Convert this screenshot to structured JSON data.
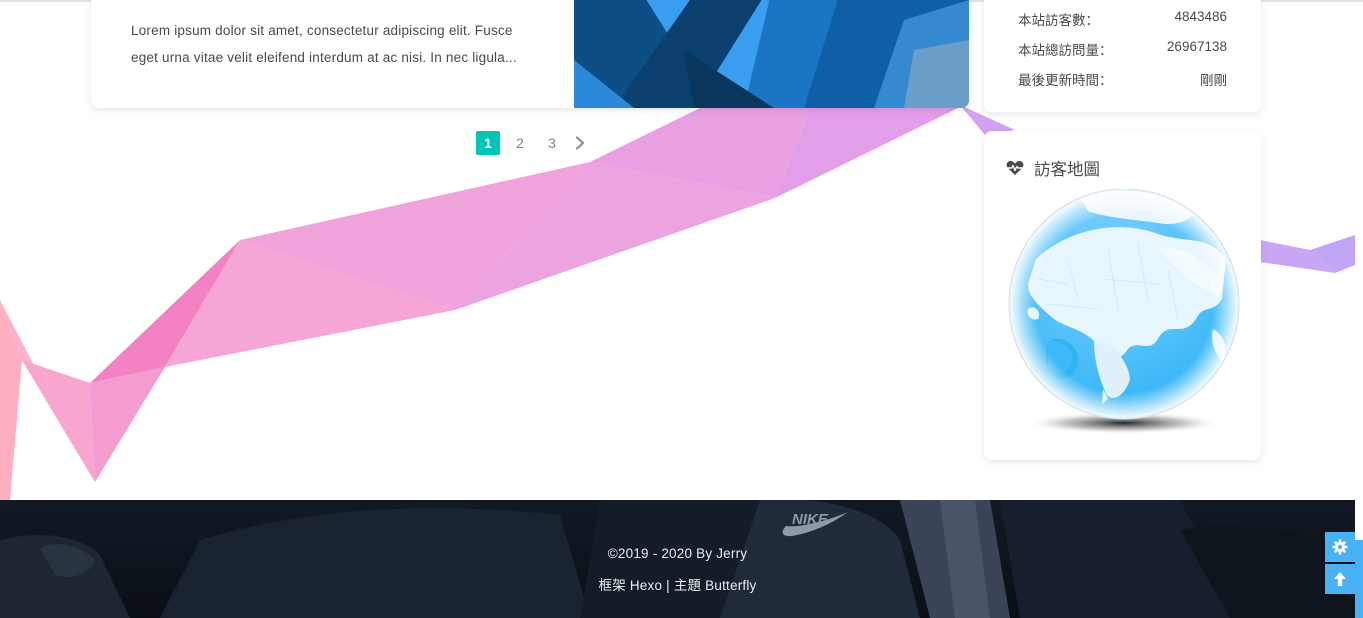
{
  "post": {
    "excerpt_line1": "Lorem ipsum dolor sit amet, consectetur adipiscing elit. Fusce",
    "excerpt_line2": "eget urna vitae velit eleifend interdum at ac nisi. In nec ligula..."
  },
  "pagination": {
    "pages": [
      "1",
      "2",
      "3"
    ],
    "current": "1",
    "next_icon": "chevron-right-icon"
  },
  "stats": {
    "items": [
      {
        "label": "本站訪客數：",
        "value": "4843486"
      },
      {
        "label": "本站總訪問量：",
        "value": "26967138"
      },
      {
        "label": "最後更新時間：",
        "value": "剛剛"
      }
    ]
  },
  "visitor_map": {
    "title": "訪客地圖",
    "icon": "heartbeat-icon"
  },
  "footer": {
    "copyright": "©2019 - 2020 By Jerry",
    "framework_prefix": "框架",
    "framework_link": "Hexo",
    "separator": "|",
    "theme_prefix": "主題",
    "theme_link": "Butterfly"
  },
  "rightside": {
    "settings_icon": "gear-icon",
    "to_top_icon": "arrow-up-icon"
  },
  "colors": {
    "accent": "#49b1f5",
    "pagination_active": "#00c4b6",
    "text": "#4c4948"
  }
}
